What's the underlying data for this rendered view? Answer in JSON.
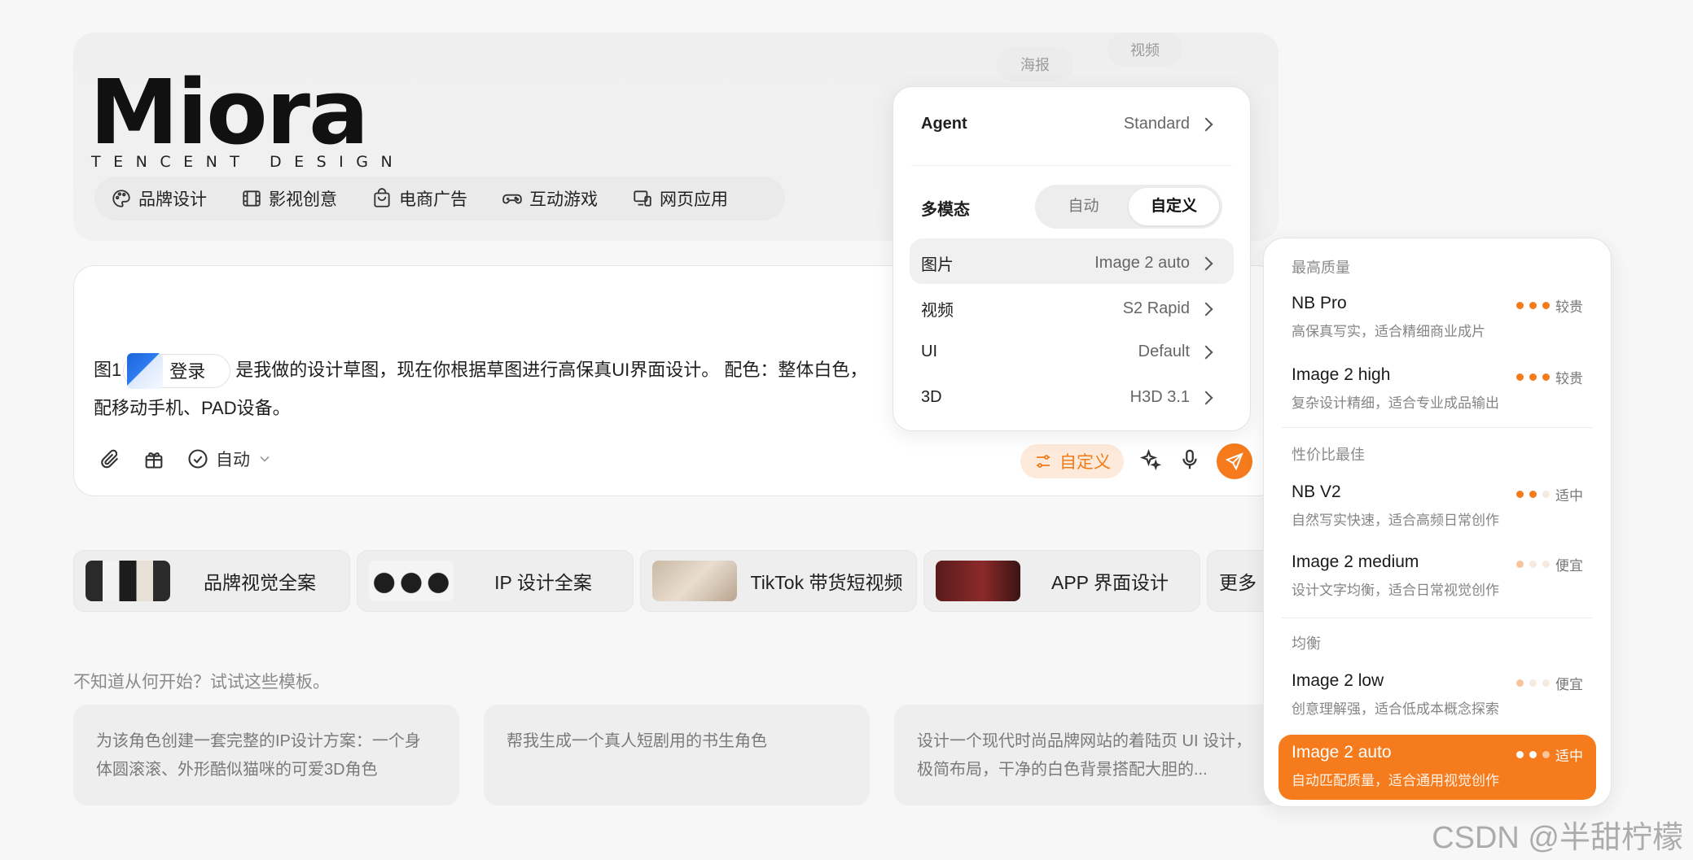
{
  "brand": {
    "wordmark": "Miora",
    "tagline": "TENCENT DESIGN"
  },
  "categories": [
    {
      "label": "品牌设计",
      "icon": "palette-icon"
    },
    {
      "label": "影视创意",
      "icon": "film-icon"
    },
    {
      "label": "电商广告",
      "icon": "shopping-bag-icon"
    },
    {
      "label": "互动游戏",
      "icon": "gamepad-icon"
    },
    {
      "label": "网页应用",
      "icon": "devices-icon"
    }
  ],
  "floating_tags": {
    "poster": "海报",
    "video": "视频"
  },
  "prompt": {
    "prefix": "图1",
    "chip_label": "登录",
    "line1_rest": "是我做的设计草图，现在你根据草图进行高保真UI界面设计。 配色：整体白色，",
    "line2": "配移动手机、PAD设备。",
    "mode_label": "自动",
    "custom_label": "自定义"
  },
  "templates": [
    {
      "label": "品牌视觉全案"
    },
    {
      "label": "IP 设计全案"
    },
    {
      "label": "TikTok 带货短视频"
    },
    {
      "label": "APP 界面设计"
    }
  ],
  "more_label": "更多",
  "hint": "不知道从何开始？试试这些模板。",
  "suggestions": [
    "为该角色创建一套完整的IP设计方案：一个身体圆滚滚、外形酷似猫咪的可爱3D角色",
    "帮我生成一个真人短剧用的书生角色",
    "设计一个现代时尚品牌网站的着陆页 UI 设计，极简布局，干净的白色背景搭配大胆的..."
  ],
  "settings_panel": {
    "agent_label": "Agent",
    "agent_value": "Standard",
    "multimodal_label": "多模态",
    "seg_auto": "自动",
    "seg_custom": "自定义",
    "rows": [
      {
        "label": "图片",
        "value": "Image 2 auto"
      },
      {
        "label": "视频",
        "value": "S2 Rapid"
      },
      {
        "label": "UI",
        "value": "Default"
      },
      {
        "label": "3D",
        "value": "H3D 3.1"
      }
    ]
  },
  "model_panel": {
    "groups": [
      {
        "title": "最高质量",
        "items": [
          {
            "name": "NB Pro",
            "desc": "高保真写实，适合精细商业成片",
            "level": 3,
            "price": "较贵"
          },
          {
            "name": "Image 2 high",
            "desc": "复杂设计精细，适合专业成品输出",
            "level": 3,
            "price": "较贵"
          }
        ]
      },
      {
        "title": "性价比最佳",
        "items": [
          {
            "name": "NB V2",
            "desc": "自然写实快速，适合高频日常创作",
            "level": 2,
            "price": "适中"
          },
          {
            "name": "Image 2 medium",
            "desc": "设计文字均衡，适合日常视觉创作",
            "level": 1,
            "price": "便宜"
          }
        ]
      },
      {
        "title": "均衡",
        "items": [
          {
            "name": "Image 2 low",
            "desc": "创意理解强，适合低成本概念探索",
            "level": 1,
            "price": "便宜"
          },
          {
            "name": "Image 2 auto",
            "desc": "自动匹配质量，适合通用视觉创作",
            "level": 2,
            "price": "适中",
            "selected": true
          }
        ]
      }
    ]
  },
  "watermark": "CSDN @半甜柠檬",
  "colors": {
    "accent": "#f57b1c",
    "accent_soft": "#fdeadb",
    "background": "#f7f7f7"
  }
}
